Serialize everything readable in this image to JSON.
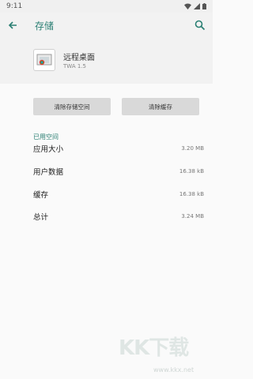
{
  "status_bar": {
    "time": "9:11"
  },
  "app_bar": {
    "title": "存储"
  },
  "app": {
    "name": "远程桌面",
    "version": "TWA 1.5"
  },
  "buttons": {
    "clear_storage": "清除存储空间",
    "clear_cache": "清除缓存"
  },
  "section_header": "已用空间",
  "usage": [
    {
      "label": "应用大小",
      "value": "3.20 MB"
    },
    {
      "label": "用户数据",
      "value": "16.38 kB"
    },
    {
      "label": "缓存",
      "value": "16.38 kB"
    },
    {
      "label": "总计",
      "value": "3.24 MB"
    }
  ],
  "watermark": {
    "logo": "KK下载",
    "url": "www.kkx.net"
  },
  "colors": {
    "accent": "#2a7f73",
    "background": "#fafafa",
    "header_bg": "#f2f2f2"
  }
}
